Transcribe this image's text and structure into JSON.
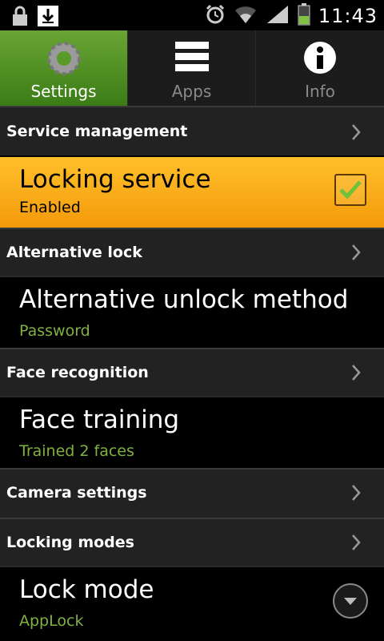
{
  "status_bar": {
    "time": "11:43",
    "icons": [
      "lock-icon",
      "download-icon",
      "alarm-icon",
      "wifi-icon",
      "signal-icon",
      "battery-icon"
    ]
  },
  "tabs": [
    {
      "label": "Settings",
      "icon": "gear-icon",
      "active": true
    },
    {
      "label": "Apps",
      "icon": "list-icon",
      "active": false
    },
    {
      "label": "Info",
      "icon": "info-icon",
      "active": false
    }
  ],
  "sections": {
    "service_management": "Service management",
    "alternative_lock": "Alternative lock",
    "face_recognition": "Face recognition",
    "camera_settings": "Camera settings",
    "locking_modes": "Locking modes"
  },
  "items": {
    "locking_service": {
      "title": "Locking service",
      "subtitle": "Enabled",
      "checked": true
    },
    "alt_unlock": {
      "title": "Alternative unlock method",
      "subtitle": "Password"
    },
    "face_training": {
      "title": "Face training",
      "subtitle": "Trained 2 faces"
    },
    "lock_mode": {
      "title": "Lock mode",
      "subtitle": "AppLock"
    }
  },
  "colors": {
    "accent_green": "#7fb241",
    "highlight_orange": "#f9ad1b",
    "tab_active": "#5a9a2b"
  }
}
